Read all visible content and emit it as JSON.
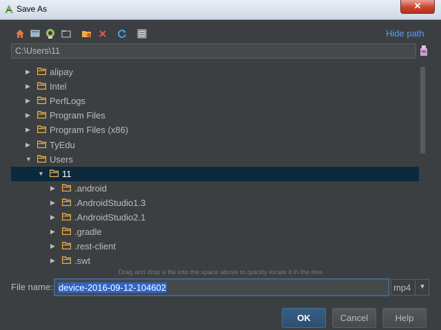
{
  "window": {
    "title": "Save As",
    "close_label": "✕"
  },
  "toolbar": {
    "icons": [
      "home-icon",
      "desktop-icon",
      "android-project-icon",
      "module-icon",
      "new-folder-icon",
      "delete-icon",
      "refresh-icon",
      "show-hidden-icon"
    ],
    "hide_path_label": "Hide path"
  },
  "path": {
    "value": "C:\\Users\\11"
  },
  "tree": {
    "items": [
      {
        "label": "alipay",
        "depth": 1,
        "expanded": false,
        "selected": false
      },
      {
        "label": "Intel",
        "depth": 1,
        "expanded": false,
        "selected": false
      },
      {
        "label": "PerfLogs",
        "depth": 1,
        "expanded": false,
        "selected": false
      },
      {
        "label": "Program Files",
        "depth": 1,
        "expanded": false,
        "selected": false
      },
      {
        "label": "Program Files (x86)",
        "depth": 1,
        "expanded": false,
        "selected": false
      },
      {
        "label": "TyEdu",
        "depth": 1,
        "expanded": false,
        "selected": false
      },
      {
        "label": "Users",
        "depth": 1,
        "expanded": true,
        "selected": false
      },
      {
        "label": "11",
        "depth": 2,
        "expanded": true,
        "selected": true
      },
      {
        "label": ".android",
        "depth": 3,
        "expanded": false,
        "selected": false
      },
      {
        "label": ".AndroidStudio1.3",
        "depth": 3,
        "expanded": false,
        "selected": false
      },
      {
        "label": ".AndroidStudio2.1",
        "depth": 3,
        "expanded": false,
        "selected": false
      },
      {
        "label": ".gradle",
        "depth": 3,
        "expanded": false,
        "selected": false
      },
      {
        "label": ".rest-client",
        "depth": 3,
        "expanded": false,
        "selected": false
      },
      {
        "label": ".swt",
        "depth": 3,
        "expanded": false,
        "selected": false
      }
    ],
    "drag_hint": "Drag and drop a file into the space above to quickly locate it in the tree"
  },
  "file_name": {
    "label": "File name:",
    "value": "device-2016-09-12-104602"
  },
  "extension": {
    "value": "mp4"
  },
  "buttons": {
    "ok": "OK",
    "cancel": "Cancel",
    "help": "Help"
  },
  "colors": {
    "background": "#3c3f41",
    "selection": "#0d293e",
    "accent": "#589df6",
    "folder": "#e8b04a"
  }
}
